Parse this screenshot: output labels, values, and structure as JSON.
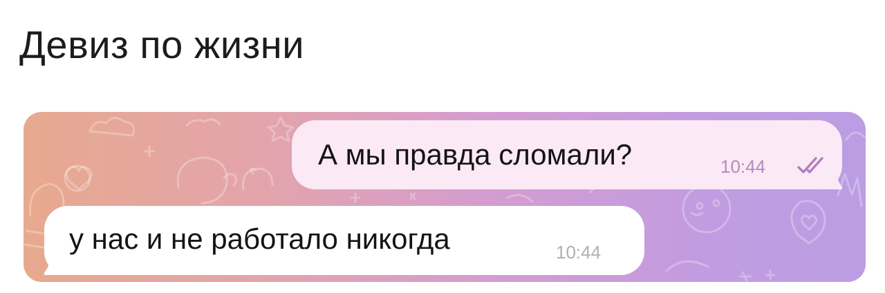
{
  "post": {
    "title": "Девиз по жизни"
  },
  "chat": {
    "messages": [
      {
        "direction": "outgoing",
        "text": "А мы правда сломали?",
        "time": "10:44",
        "status_icon": "double-check-read-icon"
      },
      {
        "direction": "incoming",
        "text": "у нас и не работало никогда",
        "time": "10:44"
      }
    ]
  },
  "colors": {
    "wallpaper_left": "#e7a98e",
    "wallpaper_right": "#bb9de3",
    "outgoing_bubble": "#fbe9f5",
    "incoming_bubble": "#ffffff",
    "read_check": "#b17fc0"
  }
}
